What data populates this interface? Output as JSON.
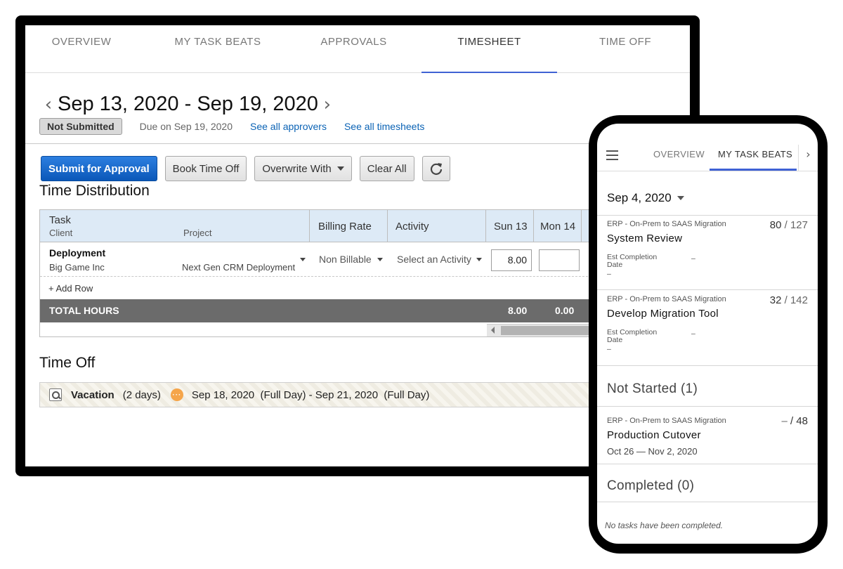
{
  "desktop": {
    "tabs": [
      {
        "label": "OVERVIEW"
      },
      {
        "label": "MY TASK BEATS"
      },
      {
        "label": "APPROVALS"
      },
      {
        "label": "TIMESHEET"
      },
      {
        "label": "TIME OFF"
      }
    ],
    "active_tab": "TIMESHEET",
    "date_range": "Sep 13, 2020 - Sep 19, 2020",
    "status": "Not Submitted",
    "due": "Due on Sep 19, 2020",
    "links": {
      "approvers": "See all approvers",
      "timesheets": "See all timesheets"
    },
    "toolbar": {
      "submit": "Submit for Approval",
      "book_time_off": "Book Time Off",
      "overwrite": "Overwrite With",
      "clear_all": "Clear All"
    },
    "time_distribution": {
      "title": "Time Distribution",
      "headers": {
        "task": "Task",
        "client": "Client",
        "project": "Project",
        "billing_rate": "Billing Rate",
        "activity": "Activity",
        "sun": "Sun 13",
        "mon": "Mon 14"
      },
      "row": {
        "task": "Deployment",
        "client": "Big Game Inc",
        "project": "Next Gen CRM Deployment",
        "billing_rate": "Non Billable",
        "activity": "Select an Activity",
        "sun_hours": "8.00",
        "mon_hours": ""
      },
      "add_row": "+ Add Row",
      "total_label": "TOTAL HOURS",
      "total_sun": "8.00",
      "total_mon": "0.00"
    },
    "time_off": {
      "title": "Time Off",
      "type": "Vacation",
      "days": "(2 days)",
      "range": "Sep 18, 2020  (Full Day) - Sep 21, 2020  (Full Day)"
    }
  },
  "mobile": {
    "tabs": {
      "overview": "OVERVIEW",
      "my_task_beats": "MY TASK BEATS"
    },
    "date": "Sep 4, 2020",
    "tasks": [
      {
        "project": "ERP - On-Prem to SAAS Migration",
        "name": "System Review",
        "done": "80",
        "total": "127",
        "est_label_1": "Est Completion",
        "est_label_2": "Date",
        "est_value": "–",
        "est_value2": "–"
      },
      {
        "project": "ERP - On-Prem to SAAS Migration",
        "name": "Develop Migration Tool",
        "done": "32",
        "total": "142",
        "est_label_1": "Est Completion",
        "est_label_2": "Date",
        "est_value": "–",
        "est_value2": "–"
      }
    ],
    "not_started": {
      "heading": "Not Started (1)",
      "task": {
        "project": "ERP - On-Prem to SAAS Migration",
        "name": "Production Cutover",
        "done": "–",
        "total": "48",
        "range": "Oct 26 — Nov 2, 2020"
      }
    },
    "completed": {
      "heading": "Completed (0)",
      "empty": "No tasks have been completed."
    }
  }
}
